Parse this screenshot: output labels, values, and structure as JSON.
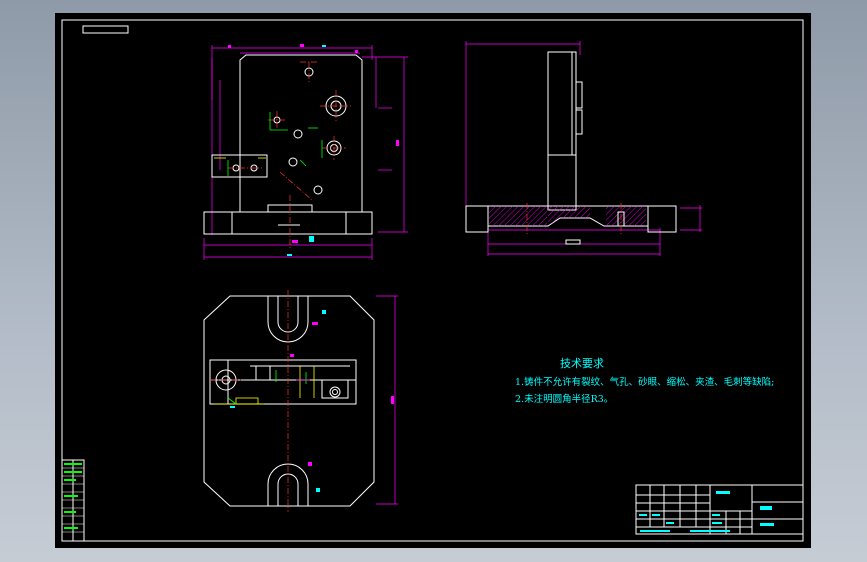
{
  "drawing": {
    "notes_title": "技术要求",
    "notes": [
      "1.铸件不允许有裂纹、气孔、砂眼、缩松、夹渣、毛刺等缺陷;",
      "2.未注明圆角半径R3。"
    ]
  },
  "colors": {
    "background": "#000000",
    "outline": "#ffffff",
    "dimension": "#ff00ff",
    "centerline": "#ff3030",
    "annotation": "#00ffff",
    "hidden": "#ffff00"
  }
}
